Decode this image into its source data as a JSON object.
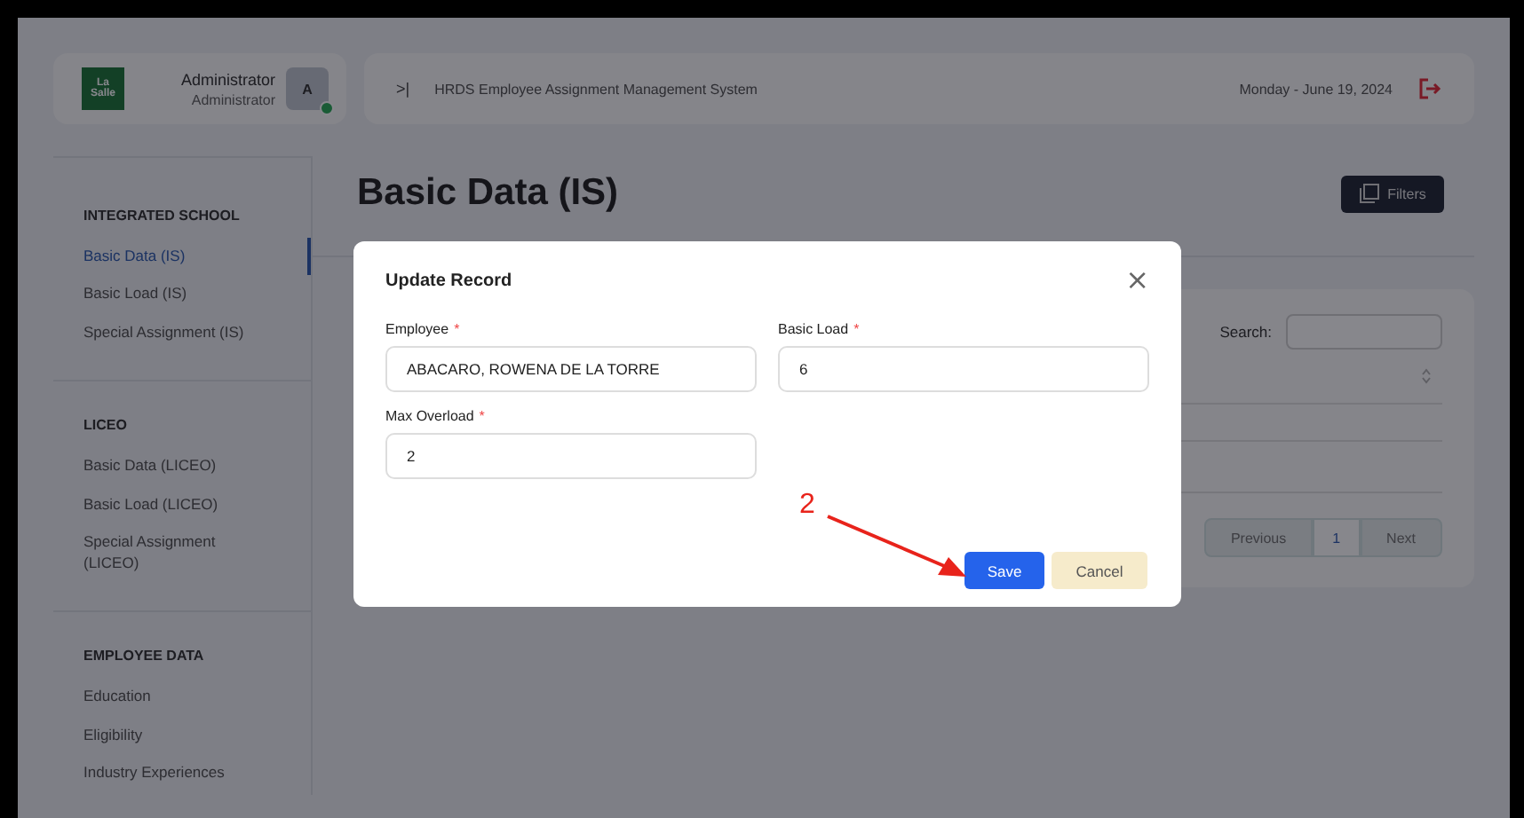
{
  "user": {
    "logo": [
      "La",
      "Salle"
    ],
    "name": "Administrator",
    "role": "Administrator",
    "avatar": "A",
    "online": true
  },
  "topbar": {
    "toggle": ">|",
    "title": "HRDS Employee Assignment Management System",
    "date": "Monday - June 19, 2024"
  },
  "sidebar": {
    "sections": [
      {
        "heading": "INTEGRATED SCHOOL",
        "items": [
          {
            "label": "Basic Data (IS)",
            "selected": true
          },
          {
            "label": "Basic Load (IS)",
            "selected": false
          },
          {
            "label": "Special Assignment (IS)",
            "selected": false
          }
        ]
      },
      {
        "heading": "LICEO",
        "items": [
          {
            "label": "Basic Data (LICEO)",
            "selected": false
          },
          {
            "label": "Basic Load (LICEO)",
            "selected": false
          },
          {
            "label": "Special Assignment (LICEO)",
            "selected": false
          }
        ]
      },
      {
        "heading": "EMPLOYEE DATA",
        "items": [
          {
            "label": "Education",
            "selected": false
          },
          {
            "label": "Eligibility",
            "selected": false
          },
          {
            "label": "Industry Experiences",
            "selected": false
          }
        ]
      }
    ]
  },
  "page": {
    "title": "Basic Data (IS)",
    "filters_button": "Filters"
  },
  "table": {
    "search_label": "Search:",
    "pagination": [
      {
        "label": "Previous",
        "selected": false
      },
      {
        "label": "1",
        "selected": true
      },
      {
        "label": "Next",
        "selected": false
      }
    ]
  },
  "modal": {
    "title": "Update Record",
    "close": "×",
    "fields": [
      {
        "label": "Employee",
        "required_mark": "*",
        "value": "ABACARO, ROWENA DE LA TORRE"
      },
      {
        "label": "Basic Load",
        "required_mark": "*",
        "value": "6"
      },
      {
        "label": "Max Overload",
        "required_mark": "*",
        "value": "2"
      }
    ],
    "buttons": [
      {
        "label": "Save",
        "kind": "primary"
      },
      {
        "label": "Cancel",
        "kind": "secondary"
      }
    ]
  },
  "annotation": {
    "label": "2"
  }
}
